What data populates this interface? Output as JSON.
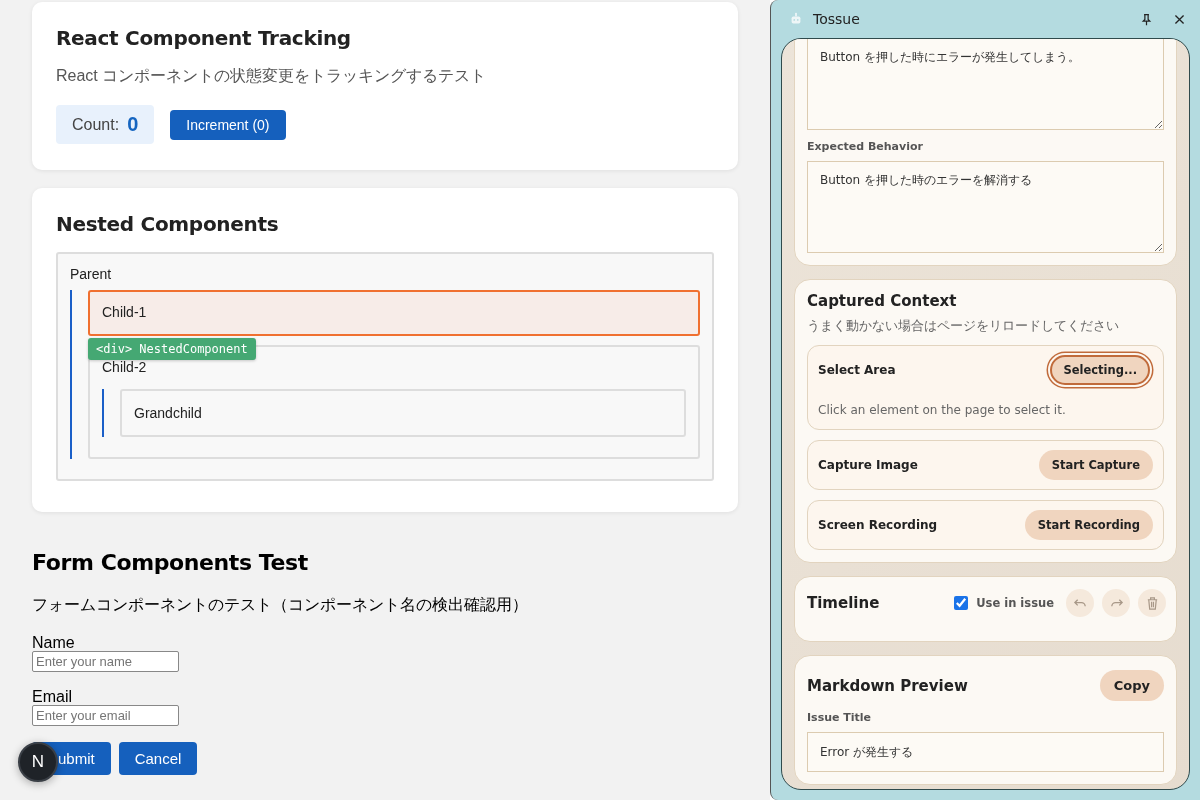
{
  "page": {
    "tracking_card": {
      "title": "React Component Tracking",
      "description": "React コンポーネントの状態変更をトラッキングするテスト",
      "count_label": "Count:",
      "count_value": "0",
      "button": "Increment (0)"
    },
    "nested_card": {
      "title": "Nested Components",
      "parent": {
        "label": "Parent",
        "children": [
          {
            "label": "Child-1",
            "highlighted": true
          },
          {
            "label": "Child-2",
            "highlighted": false,
            "children": [
              {
                "label": "Grandchild",
                "highlighted": false
              }
            ]
          }
        ]
      },
      "inspector_tag": "<div> NestedComponent"
    },
    "form": {
      "title": "Form Components Test",
      "description": "フォームコンポーネントのテスト（コンポーネント名の検出確認用）",
      "fields": [
        {
          "label": "Name",
          "placeholder": "Enter your name"
        },
        {
          "label": "Email",
          "placeholder": "Enter your email"
        }
      ],
      "buttons": [
        "ubmit",
        "Cancel"
      ]
    },
    "dev_badge": "N"
  },
  "panel": {
    "title": "Tossue",
    "issue_card": {
      "description_value": "Button を押した時にエラーが発生してしまう。",
      "expected_label": "Expected Behavior",
      "expected_value": "Button を押した時のエラーを解消する"
    },
    "context": {
      "title": "Captured Context",
      "note": "うまく動かない場合はページをリロードしてください",
      "items": [
        {
          "label": "Select Area",
          "button": "Selecting...",
          "active": true,
          "hint": "Click an element on the page to select it."
        },
        {
          "label": "Capture Image",
          "button": "Start Capture",
          "active": false
        },
        {
          "label": "Screen Recording",
          "button": "Start Recording",
          "active": false
        }
      ]
    },
    "timeline": {
      "title": "Timeline",
      "use_in_issue": {
        "label": "Use in issue",
        "checked": true
      }
    },
    "markdown": {
      "title": "Markdown Preview",
      "copy_button": "Copy",
      "issue_title_label": "Issue Title",
      "issue_title_value": "Error が発生する"
    }
  }
}
